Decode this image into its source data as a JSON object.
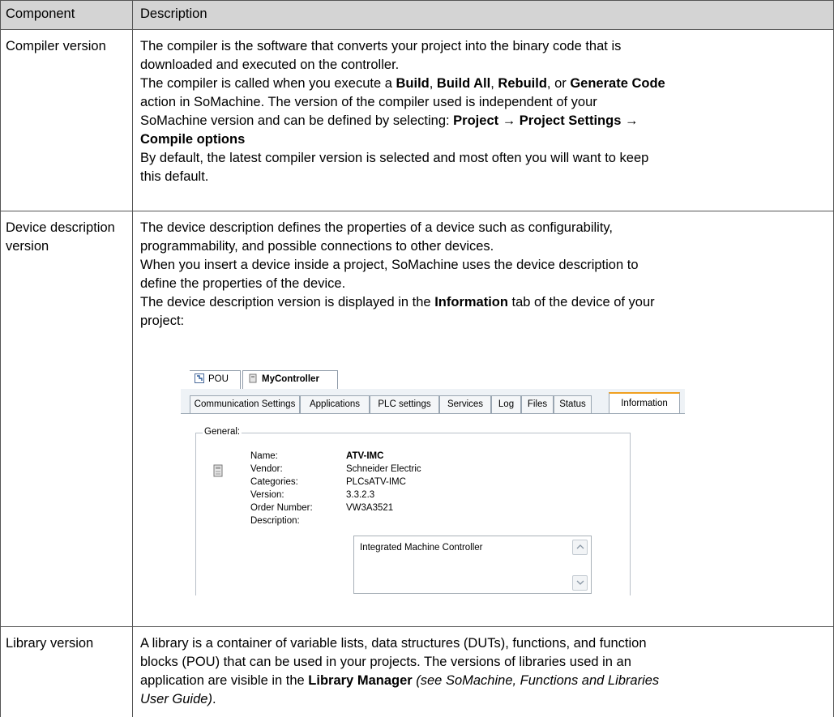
{
  "header": {
    "component": "Component",
    "description": "Description"
  },
  "rows": {
    "compiler": {
      "name": "Compiler version",
      "l1": "The compiler is the software that converts your project into the binary code that is",
      "l2": "downloaded and executed on the controller.",
      "l3a": "The compiler is called when you execute a ",
      "l3b": "Build",
      "l3c": ", ",
      "l3d": "Build All",
      "l3e": ", ",
      "l3f": "Rebuild",
      "l3g": ", or ",
      "l3h": "Generate Code",
      "l4": "action in SoMachine. The version of the compiler used is independent of your",
      "l5a": "SoMachine version and can be defined by selecting: ",
      "l5b": "Project → Project Settings →",
      "l6": "Compile options",
      "l7": "By default, the latest compiler version is selected and most often you will want to keep",
      "l8": "this default."
    },
    "device": {
      "name1": "Device description",
      "name2": "version",
      "l1": "The device description defines the properties of a device such as configurability,",
      "l2": "programmability, and possible connections to other devices.",
      "l3": "When you insert a device inside a project, SoMachine uses the device description to",
      "l4": "define the properties of the device.",
      "l5a": "The device description version is displayed in the ",
      "l5b": "Information",
      "l5c": " tab of the device of your",
      "l6": "project:"
    },
    "library": {
      "name": "Library version",
      "l1": "A library is a container of variable lists, data structures (DUTs), functions, and function",
      "l2": "blocks (POU) that can be used in your projects. The versions of libraries used in an",
      "l3a": "application are visible in the ",
      "l3b": "Library Manager",
      "l3c": " ",
      "l3d": "(see SoMachine, Functions and Libraries",
      "l4": "User Guide)",
      "l4b": "."
    }
  },
  "screenshot": {
    "top_tabs": [
      "POU",
      "MyController"
    ],
    "tabs": [
      "Communication Settings",
      "Applications",
      "PLC settings",
      "Services",
      "Log",
      "Files",
      "Status",
      "Information"
    ],
    "active_tab": "Information",
    "group_title": "General:",
    "fields": [
      {
        "label": "Name:",
        "value": "ATV-IMC"
      },
      {
        "label": "Vendor:",
        "value": "Schneider Electric"
      },
      {
        "label": "Categories:",
        "value": "PLCsATV-IMC"
      },
      {
        "label": "Version:",
        "value": "3.3.2.3"
      },
      {
        "label": "Order Number:",
        "value": "VW3A3521"
      },
      {
        "label": "Description:",
        "value": "Integrated Machine Controller"
      }
    ],
    "colors": {
      "active_tab_accent": "#f0a020",
      "tab_strip": "#eef2f6"
    }
  }
}
